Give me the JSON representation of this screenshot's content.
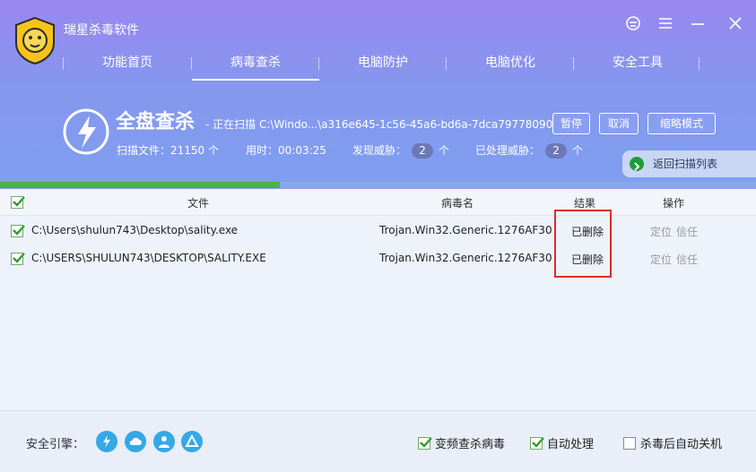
{
  "app": {
    "title": "瑞星杀毒软件"
  },
  "nav": {
    "items": [
      "功能首页",
      "病毒查杀",
      "电脑防护",
      "电脑优化",
      "安全工具"
    ],
    "active_index": 1
  },
  "scan": {
    "title": "全盘查杀",
    "progress_text": "- 正在扫描 C:\\Windo...\\a316e645-1c56-45a6-bd6a-7dca79778090",
    "buttons": {
      "pause": "暂停",
      "cancel": "取消",
      "minimize": "缩略模式"
    },
    "stats": {
      "files_label": "扫描文件：21150 个",
      "time_label": "用时：00:03:25",
      "threats_label": "发现威胁：",
      "threats_count": "2",
      "threats_unit": "个",
      "handled_label": "已处理威胁：",
      "handled_count": "2",
      "handled_unit": "个"
    },
    "return_label": "返回扫描列表",
    "progress_fraction": 0.37
  },
  "table": {
    "headers": {
      "file": "文件",
      "virus": "病毒名",
      "result": "结果",
      "action": "操作"
    },
    "rows": [
      {
        "file": "C:\\Users\\shulun743\\Desktop\\sality.exe",
        "virus": "Trojan.Win32.Generic.1276AF30",
        "result": "已删除",
        "locate": "定位",
        "trust": "信任"
      },
      {
        "file": "C:\\USERS\\SHULUN743\\DESKTOP\\SALITY.EXE",
        "virus": "Trojan.Win32.Generic.1276AF30",
        "result": "已删除",
        "locate": "定位",
        "trust": "信任"
      }
    ]
  },
  "footer": {
    "engine_label": "安全引擎：",
    "engines": [
      "lightning-icon",
      "cloud-icon",
      "user-icon",
      "recycle-icon"
    ],
    "options": [
      {
        "label": "变频查杀病毒",
        "checked": true
      },
      {
        "label": "自动处理",
        "checked": true
      },
      {
        "label": "杀毒后自动关机",
        "checked": false
      }
    ]
  },
  "colors": {
    "header_top": "#9a86f0",
    "header_bottom": "#7f9ff0",
    "progress": "#4cb243",
    "highlight": "#e02a2a",
    "check": "#2e9e2e"
  }
}
